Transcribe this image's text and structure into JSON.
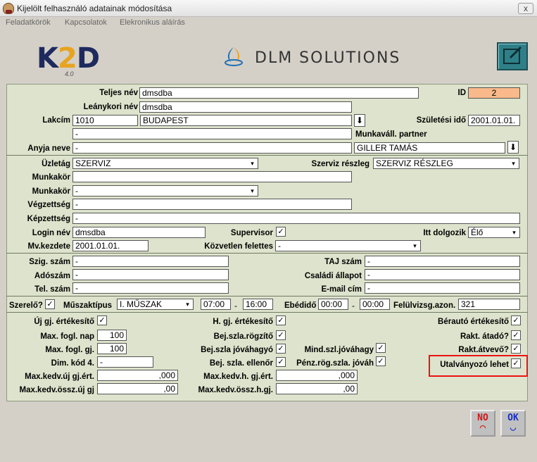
{
  "window": {
    "title": "Kijelölt felhasználó adatainak módosítása",
    "close": "x"
  },
  "menu": [
    "Feladatkörök",
    "Kapcsolatok",
    "Elekronikus aláírás"
  ],
  "logos": {
    "k2d_left": "K",
    "k2d_two": "2",
    "k2d_right": "D",
    "k2d_version": "4.0",
    "dlm": "DLM SOLUTIONS"
  },
  "labels": {
    "teljes_nev": "Teljes név",
    "leanykori_nev": "Leánykori név",
    "lakcim": "Lakcím",
    "anyja_neve": "Anyja neve",
    "id": "ID",
    "szuletesi_ido": "Születési idő",
    "munkavall_partner": "Munkaváll. partner",
    "uzletag": "Üzletág",
    "szerviz_reszleg": "Szerviz részleg",
    "munkakor1": "Munkakör",
    "munkakor2": "Munkakör",
    "vegzettseg": "Végzettség",
    "kepzettseg": "Képzettség",
    "login_nev": "Login név",
    "supervisor": "Supervisor",
    "itt_dolgozik": "Itt dolgozik",
    "mv_kezdete": "Mv.kezdete",
    "kozvetlen_felettes": "Közvetlen felettes",
    "szig_szam": "Szig. szám",
    "adoszam": "Adószám",
    "tel_szam": "Tel. szám",
    "taj_szam": "TAJ szám",
    "csaladi_allapot": "Családi állapot",
    "email": "E-mail cím",
    "szerelo": "Szerelő?",
    "muszaktipus": "Műszaktípus",
    "ebedido": "Ebédidő",
    "felulvizsg": "Felülvizsg.azon.",
    "uj_gj_ertekesito": "Új gj. értékesítő",
    "max_fogl_nap": "Max. fogl. nap",
    "max_fogl_gj": "Max. fogl. gj.",
    "dim_kod4": "Dim. kód 4.",
    "max_kedv_uj_gj_ert": "Max.kedv.új gj.ért.",
    "max_kedv_ossz_uj_gj": "Max.kedv.össz.új gj",
    "h_gj_ertekesito": "H. gj. értékesítő",
    "bej_szla_rogzito": "Bej.szla.rögzítő",
    "bej_szla_jovahagyo": "Bej.szla jóváhagyó",
    "bej_szla_ellenor": "Bej. szla. ellenőr",
    "max_kedv_h_gj_ert": "Max.kedv.h. gj.ért.",
    "max_kedv_ossz_h_gj": "Max.kedv.össz.h.gj.",
    "mind_szl_jovahagy": "Mind.szl.jóváhagy",
    "penz_rog_szla_jovah": "Pénz.rög.szla. jóváh",
    "berauto_ertekesito": "Bérautó értékesítő",
    "rakt_atado": "Rakt. átadó?",
    "rakt_atvevo": "Rakt.átvevő?",
    "utalvanyozo": "Utalványozó lehet"
  },
  "values": {
    "teljes_nev": "dmsdba",
    "leanykori_nev": "dmsdba",
    "irsz": "1010",
    "varos": "BUDAPEST",
    "cim": "-",
    "anyja_neve": "-",
    "id": "2",
    "szuletesi_ido": "2001.01.01.",
    "munkavall_partner": "GILLER TAMÁS",
    "uzletag": "SZERVIZ",
    "szerviz_reszleg": "SZERVIZ RÉSZLEG",
    "munkakor1": "",
    "munkakor2": "-",
    "vegzettseg": "-",
    "kepzettseg": "-",
    "login_nev": "dmsdba",
    "itt_dolgozik": "Élő",
    "mv_kezdete": "2001.01.01.",
    "kozvetlen_felettes": "-",
    "szig_szam": "-",
    "adoszam": "-",
    "tel_szam": "-",
    "taj_szam": "-",
    "csaladi_allapot": "-",
    "email": "-",
    "muszaktipus": "I. MŰSZAK",
    "muszak_kezd": "07:00",
    "muszak_dash": "-",
    "muszak_veg": "16:00",
    "ebed_kezd": "00:00",
    "ebed_dash": "-",
    "ebed_veg": "00:00",
    "felulvizsg": "321",
    "max_fogl_nap": "100",
    "max_fogl_gj": "100",
    "dim_kod4": "-",
    "max_kedv_uj_gj_ert": ",000",
    "max_kedv_ossz_uj_gj": ",00",
    "max_kedv_h_gj_ert": ",000",
    "max_kedv_ossz_h_gj": ",00"
  },
  "checks": {
    "mark": "✓",
    "arrow": "▾",
    "down": "⬇"
  },
  "buttons": {
    "no": "NO",
    "ok": "OK",
    "no_face": "⌒",
    "ok_face": "◡"
  }
}
